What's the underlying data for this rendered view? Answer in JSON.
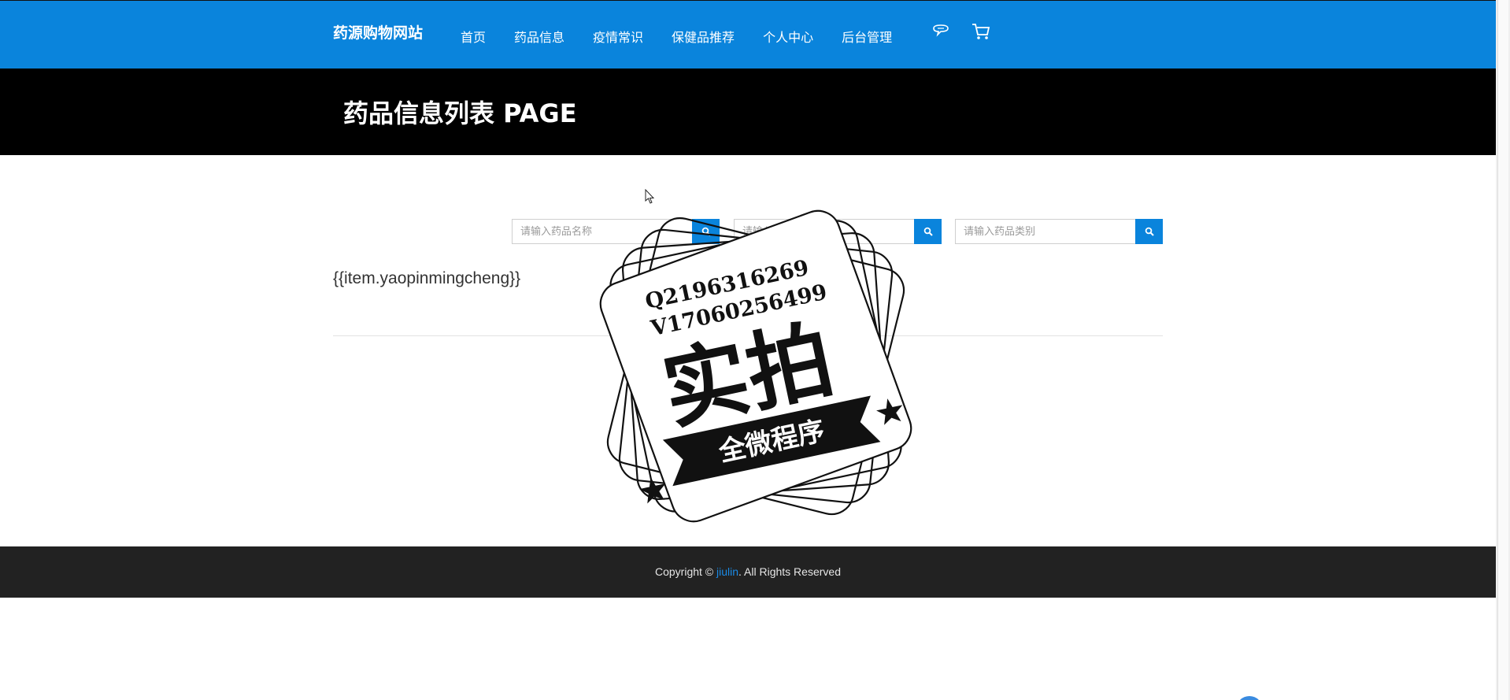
{
  "header": {
    "brand": "药源购物网站",
    "nav": [
      {
        "label": "首页"
      },
      {
        "label": "药品信息"
      },
      {
        "label": "疫情常识"
      },
      {
        "label": "保健品推荐"
      },
      {
        "label": "个人中心"
      },
      {
        "label": "后台管理"
      }
    ],
    "icons": [
      "chat-icon",
      "cart-icon"
    ]
  },
  "banner": {
    "title": "药品信息列表 PAGE"
  },
  "search": [
    {
      "placeholder": "请输入药品名称",
      "icon": "search-icon"
    },
    {
      "placeholder": "请输入药品类型",
      "icon": "search-icon"
    },
    {
      "placeholder": "请输入药品类别",
      "icon": "search-icon"
    }
  ],
  "list": {
    "item_title": "{{item.yaopinmingcheng}}"
  },
  "stamp": {
    "line1": "Q2196316269",
    "line2": "V17060256499",
    "main": "实拍",
    "ribbon": "全微程序"
  },
  "footer": {
    "prefix": "Copyright © ",
    "link": "jiulin",
    "suffix": ". All Rights Reserved"
  },
  "colors": {
    "primary": "#0a84dc",
    "banner": "#000000",
    "footer": "#222222"
  }
}
